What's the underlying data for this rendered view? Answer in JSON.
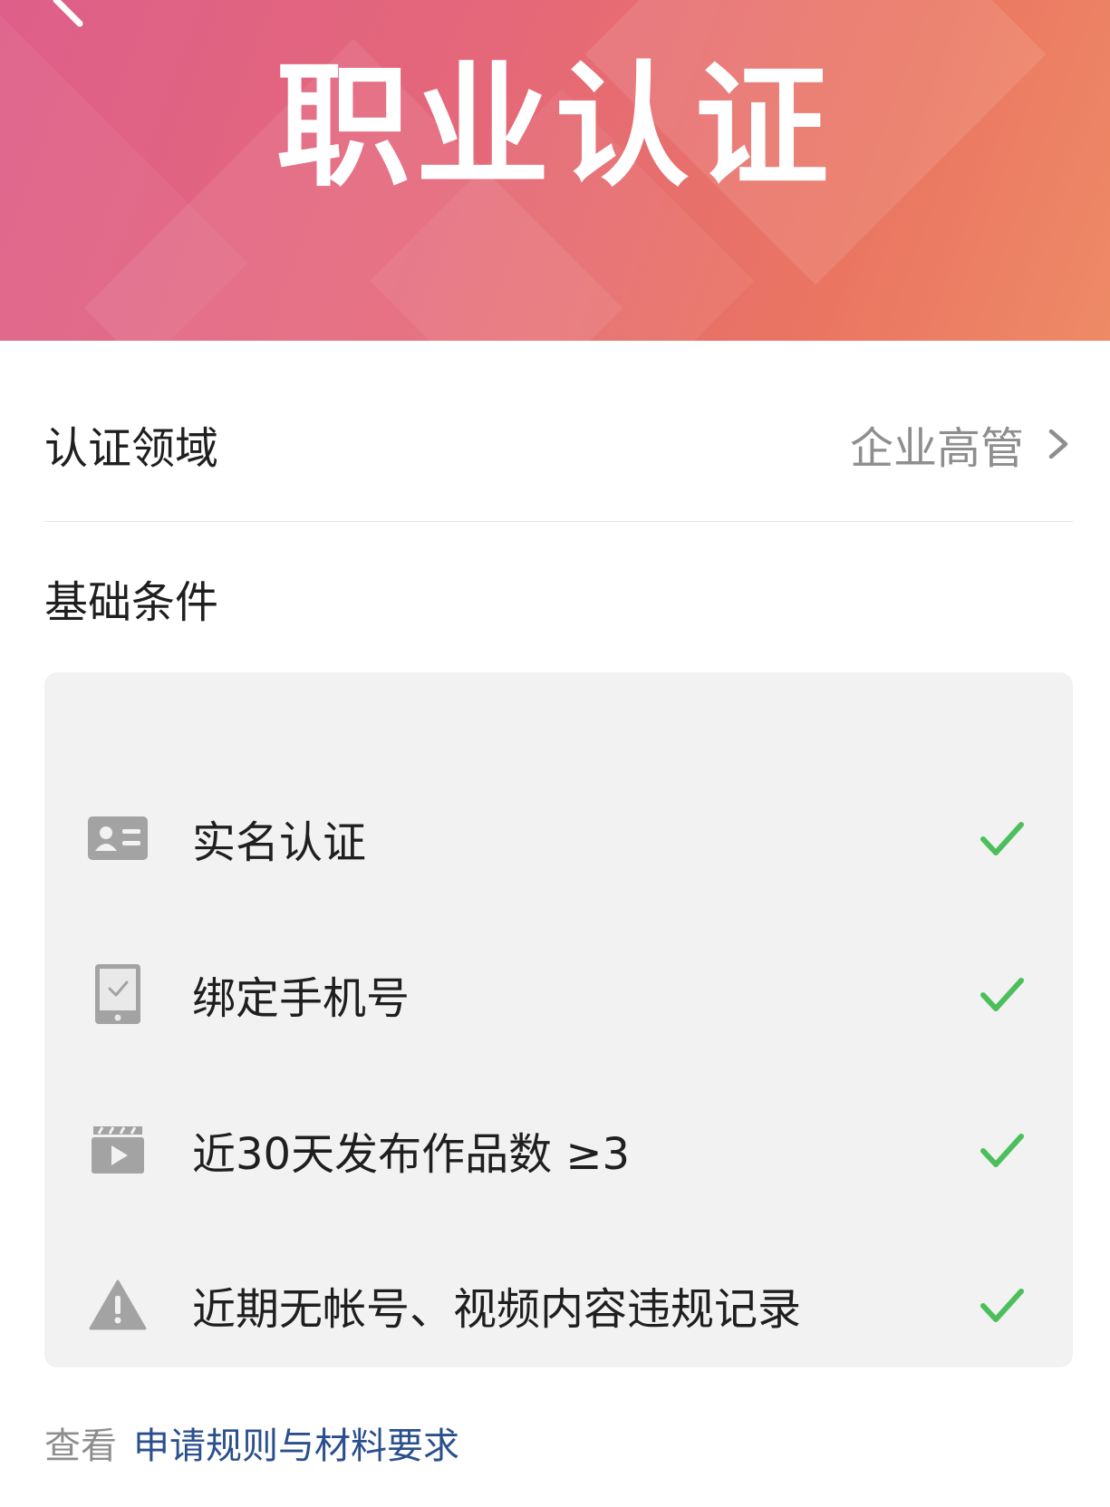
{
  "header": {
    "title": "职业认证",
    "back_icon": "back-arrow-icon",
    "gradient_colors": [
      "#de5f8a",
      "#ea7562",
      "#ee8a66"
    ]
  },
  "field": {
    "label": "认证领域",
    "value": "企业高管"
  },
  "section": {
    "title": "基础条件"
  },
  "conditions": [
    {
      "icon": "id-card-icon",
      "label": "实名认证",
      "status": "satisfied"
    },
    {
      "icon": "phone-icon",
      "label": "绑定手机号",
      "status": "satisfied"
    },
    {
      "icon": "video-clapper-icon",
      "label": "近30天发布作品数 ≥3",
      "status": "satisfied"
    },
    {
      "icon": "warning-icon",
      "label": "近期无帐号、视频内容违规记录",
      "status": "satisfied"
    }
  ],
  "footer": {
    "prefix": "查看",
    "link": "申请规则与材料要求"
  },
  "colors": {
    "check": "#4cbf5c",
    "link": "#2a4f8d",
    "card_bg": "#f2f2f2",
    "muted_text": "#8e8e8e"
  }
}
